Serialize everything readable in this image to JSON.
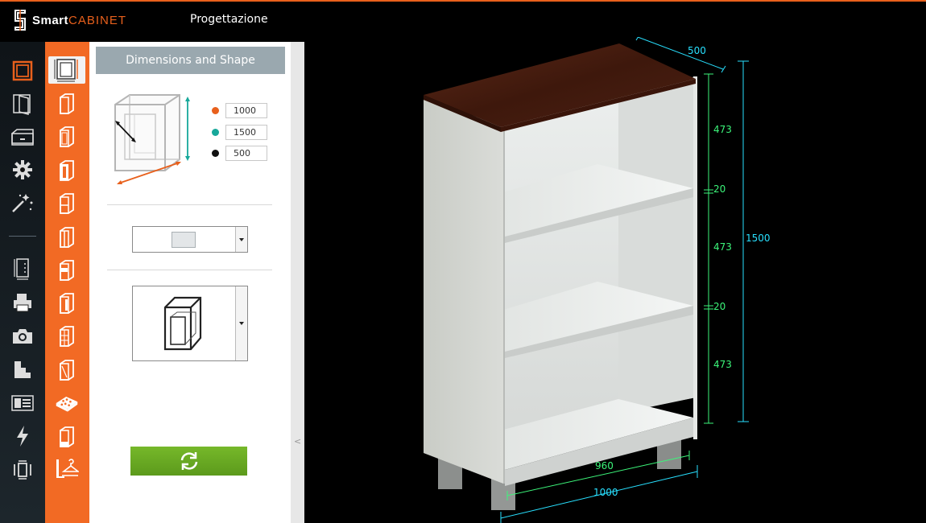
{
  "app": {
    "brand_bold": "Smart",
    "brand_light": "CABINET",
    "section_title": "Progettazione"
  },
  "nav": {
    "items": [
      {
        "name": "cabinet-frame-icon",
        "active": true
      },
      {
        "name": "door-icon"
      },
      {
        "name": "drawer-icon"
      },
      {
        "name": "gear-icon"
      },
      {
        "name": "magic-wand-icon"
      },
      {
        "name": "panel-cutlist-icon"
      },
      {
        "name": "printer-icon"
      },
      {
        "name": "camera-icon"
      },
      {
        "name": "stairs-icon"
      },
      {
        "name": "layout-list-icon"
      },
      {
        "name": "lightning-icon"
      },
      {
        "name": "compact-icon"
      }
    ]
  },
  "types": {
    "items": [
      {
        "name": "dimensions-shape-icon",
        "active": true
      },
      {
        "name": "cabinet-type-1-icon"
      },
      {
        "name": "cabinet-type-2-icon"
      },
      {
        "name": "cabinet-type-3-icon"
      },
      {
        "name": "cabinet-type-4-icon"
      },
      {
        "name": "cabinet-type-5-icon"
      },
      {
        "name": "cabinet-type-6-icon"
      },
      {
        "name": "cabinet-type-7-icon"
      },
      {
        "name": "cabinet-grid-icon"
      },
      {
        "name": "cabinet-type-9-icon"
      },
      {
        "name": "cabinet-holes-icon"
      },
      {
        "name": "cabinet-type-11-icon"
      },
      {
        "name": "hanger-rail-icon"
      }
    ]
  },
  "panel": {
    "header": "Dimensions and Shape",
    "width": {
      "value": "1000",
      "color": "#e8601c"
    },
    "height": {
      "value": "1500",
      "color": "#17a89a"
    },
    "depth": {
      "value": "500",
      "color": "#111111"
    }
  },
  "colors": {
    "accent": "#f26a24",
    "apply": "#6aaa22",
    "dimension_cyan": "#28e0ff",
    "dimension_green": "#3cf57a",
    "top_wood": "#4a1e12",
    "carcass": "#d8dad6"
  },
  "dimensions": {
    "top_depth": "500",
    "total_height": "1500",
    "section_1": "473",
    "gap_1": "20",
    "section_2": "473",
    "gap_2": "20",
    "section_3": "473",
    "inner_width": "960",
    "outer_width": "1000"
  }
}
